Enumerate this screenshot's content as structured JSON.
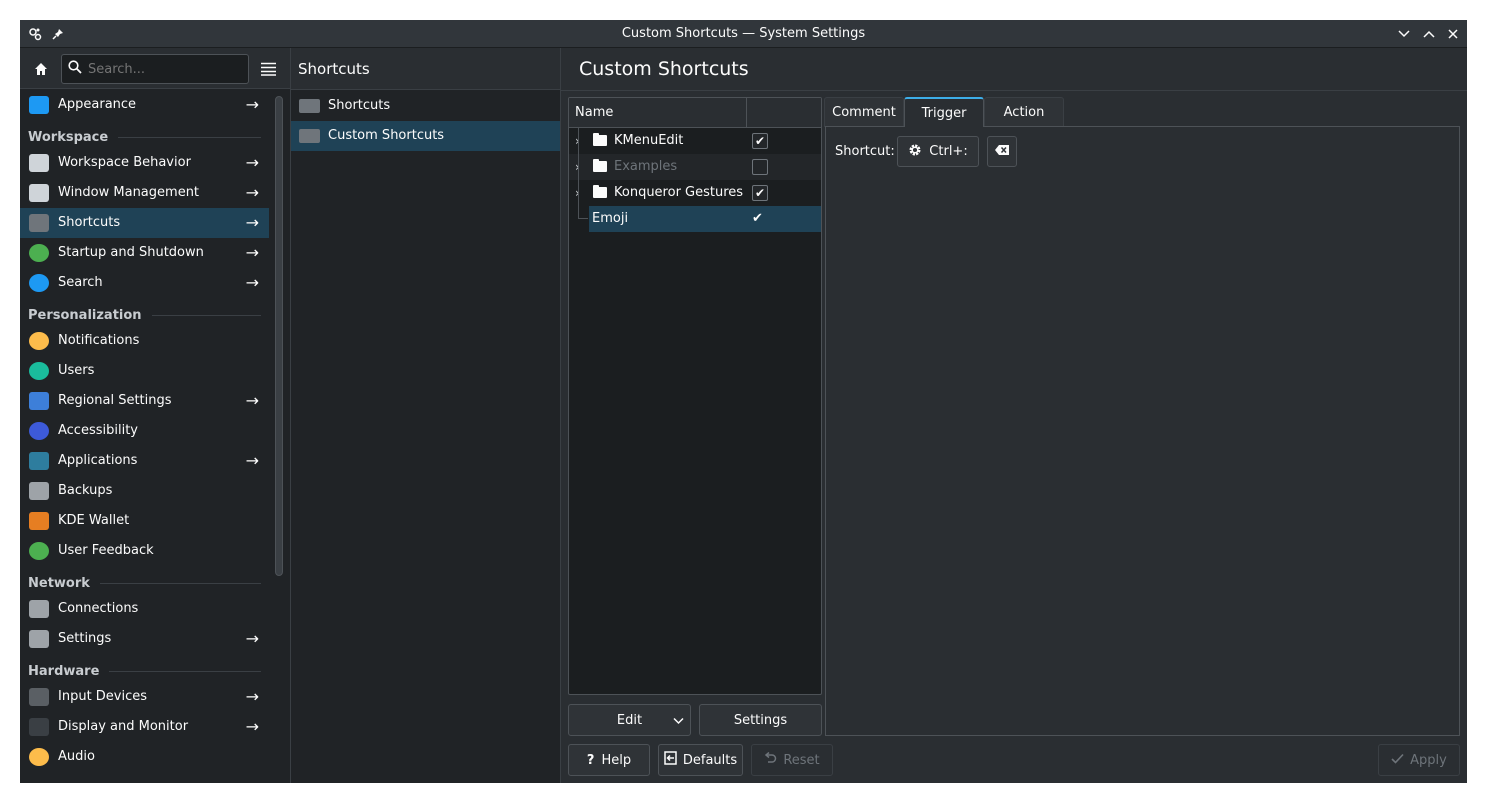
{
  "window": {
    "title": "Custom Shortcuts — System Settings"
  },
  "sidebar": {
    "search_placeholder": "Search...",
    "items": [
      {
        "type": "item",
        "label": "Appearance",
        "arrow": true,
        "icon": "appearance-icon",
        "color": "#1d99f3"
      },
      {
        "type": "cat",
        "label": "Workspace"
      },
      {
        "type": "item",
        "label": "Workspace Behavior",
        "arrow": true,
        "icon": "workspace-icon",
        "color": "#cfd4d9"
      },
      {
        "type": "item",
        "label": "Window Management",
        "arrow": true,
        "icon": "window-icon",
        "color": "#cfd4d9"
      },
      {
        "type": "item",
        "label": "Shortcuts",
        "arrow": true,
        "selected": true,
        "icon": "keyboard-icon",
        "color": "#6f757b"
      },
      {
        "type": "item",
        "label": "Startup and Shutdown",
        "arrow": true,
        "icon": "rocket-icon",
        "color": "#4caf50"
      },
      {
        "type": "item",
        "label": "Search",
        "arrow": true,
        "icon": "search-icon",
        "color": "#1d99f3"
      },
      {
        "type": "cat",
        "label": "Personalization"
      },
      {
        "type": "item",
        "label": "Notifications",
        "arrow": false,
        "icon": "bell-icon",
        "color": "#fdbc4b"
      },
      {
        "type": "item",
        "label": "Users",
        "arrow": false,
        "icon": "user-icon",
        "color": "#1abc9c"
      },
      {
        "type": "item",
        "label": "Regional Settings",
        "arrow": true,
        "icon": "language-icon",
        "color": "#3d7fd9"
      },
      {
        "type": "item",
        "label": "Accessibility",
        "arrow": false,
        "icon": "accessibility-icon",
        "color": "#3d5ad9"
      },
      {
        "type": "item",
        "label": "Applications",
        "arrow": true,
        "icon": "applications-icon",
        "color": "#2e7d9e"
      },
      {
        "type": "item",
        "label": "Backups",
        "arrow": false,
        "icon": "backup-icon",
        "color": "#9ea3a8"
      },
      {
        "type": "item",
        "label": "KDE Wallet",
        "arrow": false,
        "icon": "wallet-icon",
        "color": "#e67e22"
      },
      {
        "type": "item",
        "label": "User Feedback",
        "arrow": false,
        "icon": "feedback-icon",
        "color": "#4caf50"
      },
      {
        "type": "cat",
        "label": "Network"
      },
      {
        "type": "item",
        "label": "Connections",
        "arrow": false,
        "icon": "network-icon",
        "color": "#9ea3a8"
      },
      {
        "type": "item",
        "label": "Settings",
        "arrow": true,
        "icon": "network-settings-icon",
        "color": "#9ea3a8"
      },
      {
        "type": "cat",
        "label": "Hardware"
      },
      {
        "type": "item",
        "label": "Input Devices",
        "arrow": true,
        "icon": "mouse-icon",
        "color": "#5a5f64"
      },
      {
        "type": "item",
        "label": "Display and Monitor",
        "arrow": true,
        "icon": "monitor-icon",
        "color": "#3a3f44"
      },
      {
        "type": "item",
        "label": "Audio",
        "arrow": false,
        "icon": "audio-icon",
        "color": "#fdbc4b"
      }
    ]
  },
  "column2": {
    "title": "Shortcuts",
    "items": [
      {
        "label": "Shortcuts",
        "selected": false
      },
      {
        "label": "Custom Shortcuts",
        "selected": true
      }
    ]
  },
  "main": {
    "title": "Custom Shortcuts",
    "tree": {
      "header_name": "Name",
      "rows": [
        {
          "label": "KMenuEdit",
          "folder": true,
          "checked": true,
          "dim": false
        },
        {
          "label": "Examples",
          "folder": true,
          "checked": false,
          "dim": true
        },
        {
          "label": "Konqueror Gestures",
          "folder": true,
          "checked": true,
          "dim": false
        }
      ],
      "selected_row": {
        "label": "Emoji",
        "checked": true
      }
    },
    "edit_label": "Edit",
    "settings_label": "Settings",
    "tabs": [
      "Comment",
      "Trigger",
      "Action"
    ],
    "active_tab": "Trigger",
    "shortcut_label": "Shortcut:",
    "shortcut_value": "Ctrl+:",
    "help_label": "Help",
    "defaults_label": "Defaults",
    "reset_label": "Reset",
    "apply_label": "Apply"
  }
}
